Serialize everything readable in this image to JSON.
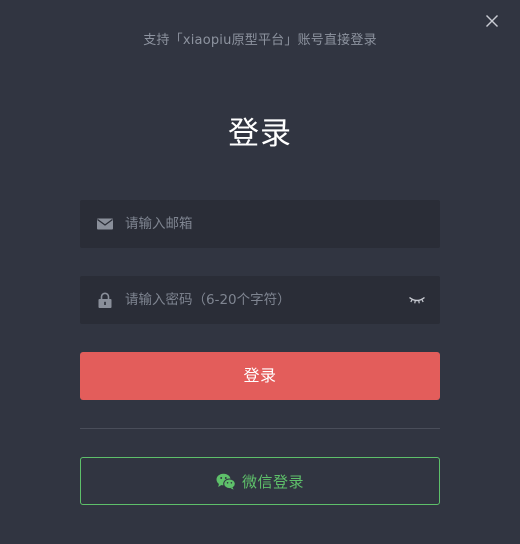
{
  "dialog": {
    "subtitle": "支持「xiaopiu原型平台」账号直接登录",
    "title": "登录",
    "close_icon": "close-icon"
  },
  "form": {
    "email": {
      "icon": "envelope-icon",
      "value": "",
      "placeholder": "请输入邮箱"
    },
    "password": {
      "icon": "lock-icon",
      "value": "",
      "placeholder": "请输入密码（6-20个字符）",
      "toggle_icon": "eye-closed-icon"
    },
    "submit_label": "登录"
  },
  "alt_login": {
    "icon": "wechat-icon",
    "label": "微信登录"
  },
  "colors": {
    "background": "#313541",
    "field_background": "#2a2d37",
    "primary": "#e35d5b",
    "wechat_green": "#5ec06a",
    "subtitle_text": "#8d939f",
    "placeholder_text": "#7f8591"
  }
}
